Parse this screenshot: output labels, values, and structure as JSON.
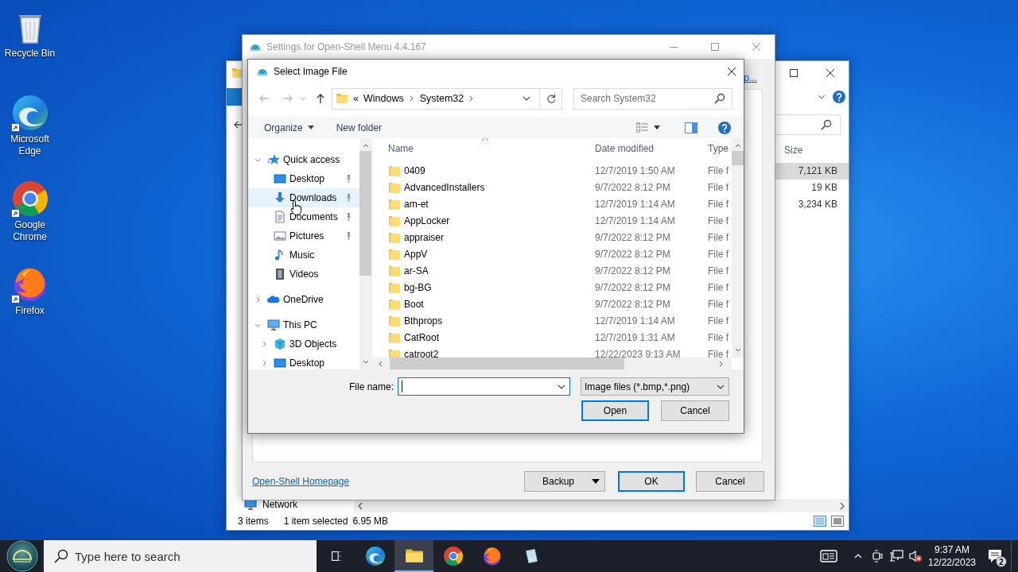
{
  "desktop_icons": [
    {
      "label": "Recycle Bin",
      "kind": "bin",
      "shortcut": false
    },
    {
      "label": "Microsoft Edge",
      "kind": "wave",
      "shortcut": true
    },
    {
      "label": "Google Chrome",
      "kind": "ring",
      "shortcut": true
    },
    {
      "label": "Firefox",
      "kind": "fox",
      "shortcut": true
    }
  ],
  "explorer_window": {
    "nav": [
      {
        "label": "Network",
        "kind": "network"
      }
    ],
    "columns": [
      {
        "label": "Size"
      }
    ],
    "rows": [
      {
        "size": "7,121 KB",
        "selected": true
      },
      {
        "size": "19 KB",
        "selected": false
      },
      {
        "size": "3,234 KB",
        "selected": false
      }
    ],
    "status_bar": {
      "item_count": "3 items",
      "selection": "1 item selected",
      "selection_size": "6.95 MB"
    }
  },
  "settings_window": {
    "title": "Settings for Open-Shell Menu 4.4.167",
    "active": false,
    "top_link": "p...",
    "homepage_link": "Open-Shell Homepage",
    "buttons": [
      {
        "label": "Backup",
        "kind": "split"
      },
      {
        "label": "OK",
        "kind": "default"
      },
      {
        "label": "Cancel",
        "kind": "plain"
      }
    ]
  },
  "dialog": {
    "title": "Select Image File",
    "overflow": "«",
    "breadcrumb": [
      "Windows",
      "System32"
    ],
    "search": {
      "placeholder": "Search System32"
    },
    "toolbar": [
      {
        "label": "Organize",
        "kind": "menu"
      },
      {
        "label": "New folder",
        "kind": "plain"
      }
    ],
    "nav": [
      {
        "label": "Quick access",
        "kind": "star",
        "expanded": true,
        "selected": false,
        "children": [
          {
            "label": "Desktop",
            "kind": "monitor",
            "pinned": true,
            "selected": false
          },
          {
            "label": "Downloads",
            "kind": "download",
            "pinned": true,
            "selected": true
          },
          {
            "label": "Documents",
            "kind": "document",
            "pinned": true,
            "selected": false
          },
          {
            "label": "Pictures",
            "kind": "picture",
            "pinned": true,
            "selected": false
          },
          {
            "label": "Music",
            "kind": "music",
            "pinned": false,
            "selected": false
          },
          {
            "label": "Videos",
            "kind": "video",
            "pinned": false,
            "selected": false
          }
        ]
      },
      {
        "label": "OneDrive",
        "kind": "cloud",
        "expanded": false,
        "selected": false
      },
      {
        "label": "This PC",
        "kind": "computer",
        "expanded": true,
        "selected": false,
        "children": [
          {
            "label": "3D Objects",
            "kind": "cube",
            "expanded": false,
            "selected": false
          },
          {
            "label": "Desktop",
            "kind": "monitor",
            "expanded": false,
            "selected": false
          }
        ]
      }
    ],
    "columns": [
      {
        "label": "Name"
      },
      {
        "label": "Date modified"
      },
      {
        "label": "Type"
      }
    ],
    "rows": [
      {
        "name": "0409",
        "date": "12/7/2019 1:50 AM",
        "type": "File f"
      },
      {
        "name": "AdvancedInstallers",
        "date": "9/7/2022 8:12 PM",
        "type": "File f"
      },
      {
        "name": "am-et",
        "date": "12/7/2019 1:14 AM",
        "type": "File f"
      },
      {
        "name": "AppLocker",
        "date": "12/7/2019 1:14 AM",
        "type": "File f"
      },
      {
        "name": "appraiser",
        "date": "9/7/2022 8:12 PM",
        "type": "File f"
      },
      {
        "name": "AppV",
        "date": "9/7/2022 8:12 PM",
        "type": "File f"
      },
      {
        "name": "ar-SA",
        "date": "9/7/2022 8:12 PM",
        "type": "File f"
      },
      {
        "name": "bg-BG",
        "date": "9/7/2022 8:12 PM",
        "type": "File f"
      },
      {
        "name": "Boot",
        "date": "9/7/2022 8:12 PM",
        "type": "File f"
      },
      {
        "name": "Bthprops",
        "date": "12/7/2019 1:14 AM",
        "type": "File f"
      },
      {
        "name": "CatRoot",
        "date": "12/7/2019 1:31 AM",
        "type": "File f"
      },
      {
        "name": "catroot2",
        "date": "12/22/2023 9:13 AM",
        "type": "File f"
      }
    ],
    "file_name": {
      "label": "File name:",
      "focused": true
    },
    "filter": "Image files (*.bmp,*.png)",
    "buttons": [
      {
        "label": "Open",
        "kind": "default"
      },
      {
        "label": "Cancel",
        "kind": "plain"
      }
    ]
  },
  "taskbar": {
    "search": {
      "placeholder": "Type here to search"
    },
    "apps": [
      {
        "kind": "taskview",
        "active": false
      },
      {
        "kind": "wave",
        "active": false
      },
      {
        "kind": "folder",
        "active": true
      },
      {
        "kind": "ring",
        "active": false
      },
      {
        "kind": "fox",
        "active": false
      },
      {
        "kind": "notepad",
        "active": false
      }
    ],
    "volume_muted": true,
    "time": "9:37 AM",
    "date": "12/22/2023",
    "notifications": "2"
  }
}
